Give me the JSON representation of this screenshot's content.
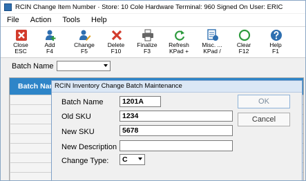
{
  "window": {
    "title": "RCIN Change Item Number  ·  Store: 10   Cole Hardware   Terminal: 960   Signed On User: ERIC"
  },
  "menu": {
    "items": [
      "File",
      "Action",
      "Tools",
      "Help"
    ]
  },
  "toolbar": {
    "buttons": [
      {
        "name": "close",
        "line1": "Close",
        "line2": "ESC",
        "icon": "close-x-icon",
        "color": "#d23b2c"
      },
      {
        "name": "add",
        "line1": "Add",
        "line2": "F4",
        "icon": "add-user-icon",
        "color": "#2e6fb0"
      },
      {
        "name": "change",
        "line1": "Change",
        "line2": "F5",
        "icon": "edit-user-icon",
        "color": "#2e6fb0"
      },
      {
        "name": "delete",
        "line1": "Delete",
        "line2": "F10",
        "icon": "delete-x-icon",
        "color": "#d23b2c"
      },
      {
        "name": "finalize",
        "line1": "Finalize",
        "line2": "F3",
        "icon": "printer-icon",
        "color": "#555555"
      },
      {
        "name": "refresh",
        "line1": "Refresh",
        "line2": "KPad +",
        "icon": "refresh-icon",
        "color": "#2e9a3e"
      },
      {
        "name": "misc",
        "line1": "Misc. ...",
        "line2": "KPad /",
        "icon": "misc-document-icon",
        "color": "#2e6fb0"
      },
      {
        "name": "clear",
        "line1": "Clear",
        "line2": "F12",
        "icon": "clear-circle-icon",
        "color": "#2e9a3e"
      },
      {
        "name": "help",
        "line1": "Help",
        "line2": "F1",
        "icon": "help-question-icon",
        "color": "#2e6fb0"
      }
    ]
  },
  "batch": {
    "label": "Batch Name",
    "value": ""
  },
  "grid": {
    "columns": [
      "Batch Name"
    ]
  },
  "dialog": {
    "title": "RCIN Inventory Change Batch Maintenance",
    "batch_name_label": "Batch Name",
    "batch_name_value": "1201A",
    "old_sku_label": "Old SKU",
    "old_sku_value": "1234",
    "new_sku_label": "New SKU",
    "new_sku_value": "5678",
    "new_desc_label": "New Description",
    "new_desc_value": "",
    "change_type_label": "Change Type:",
    "change_type_value": "C",
    "ok_label": "OK",
    "cancel_label": "Cancel"
  }
}
